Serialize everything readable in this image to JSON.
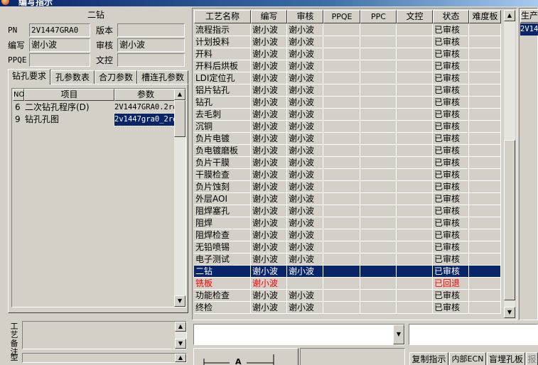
{
  "window": {
    "title": "编写指示"
  },
  "header": {
    "title": "二钻"
  },
  "fields": {
    "pn_label": "PN",
    "pn_value": "2V1447GRA0",
    "version_label": "版本",
    "version_value": "",
    "writer_label": "编写",
    "writer_value": "谢小波",
    "reviewer_label": "审核",
    "reviewer_value": "谢小波",
    "ppqe_label": "PPQE",
    "ppqe_value": "",
    "doc_control_label": "文控",
    "doc_control_value": ""
  },
  "tabs": [
    "钻孔要求",
    "孔参数表",
    "合刀参数",
    "槽连孔参数"
  ],
  "left_grid": {
    "headers": [
      "NO",
      "项目",
      "参数"
    ],
    "rows": [
      {
        "no": "6",
        "item": "二次钻孔程序(D)",
        "param": "2V1447GRA0.2rd"
      },
      {
        "no": "9",
        "item": "钻孔孔图",
        "param": "2v1447gra0_2rd"
      }
    ]
  },
  "remarks": {
    "label1": "工艺备注",
    "label2": "型"
  },
  "main_grid": {
    "headers": [
      "工艺名称",
      "编写",
      "审核",
      "PPQE",
      "PPC",
      "文控",
      "状态",
      "难度板"
    ],
    "rows": [
      {
        "name": "流程指示",
        "writer": "谢小波",
        "reviewer": "谢小波",
        "status": "已审核"
      },
      {
        "name": "计划投料",
        "writer": "谢小波",
        "reviewer": "谢小波",
        "status": "已审核"
      },
      {
        "name": "开料",
        "writer": "谢小波",
        "reviewer": "谢小波",
        "status": "已审核"
      },
      {
        "name": "开料后烘板",
        "writer": "谢小波",
        "reviewer": "谢小波",
        "status": "已审核"
      },
      {
        "name": "LDI定位孔",
        "writer": "谢小波",
        "reviewer": "谢小波",
        "status": "已审核"
      },
      {
        "name": "铝片钻孔",
        "writer": "谢小波",
        "reviewer": "谢小波",
        "status": "已审核"
      },
      {
        "name": "钻孔",
        "writer": "谢小波",
        "reviewer": "谢小波",
        "status": "已审核"
      },
      {
        "name": "去毛刺",
        "writer": "谢小波",
        "reviewer": "谢小波",
        "status": "已审核"
      },
      {
        "name": "沉铜",
        "writer": "谢小波",
        "reviewer": "谢小波",
        "status": "已审核"
      },
      {
        "name": "负片电镀",
        "writer": "谢小波",
        "reviewer": "谢小波",
        "status": "已审核"
      },
      {
        "name": "负电镀磨板",
        "writer": "谢小波",
        "reviewer": "谢小波",
        "status": "已审核"
      },
      {
        "name": "负片干膜",
        "writer": "谢小波",
        "reviewer": "谢小波",
        "status": "已审核"
      },
      {
        "name": "干膜检查",
        "writer": "谢小波",
        "reviewer": "谢小波",
        "status": "已审核"
      },
      {
        "name": "负片蚀刻",
        "writer": "谢小波",
        "reviewer": "谢小波",
        "status": "已审核"
      },
      {
        "name": "外层AOI",
        "writer": "谢小波",
        "reviewer": "谢小波",
        "status": "已审核"
      },
      {
        "name": "阻焊塞孔",
        "writer": "谢小波",
        "reviewer": "谢小波",
        "status": "已审核"
      },
      {
        "name": "阻焊",
        "writer": "谢小波",
        "reviewer": "谢小波",
        "status": "已审核"
      },
      {
        "name": "阻焊检查",
        "writer": "谢小波",
        "reviewer": "谢小波",
        "status": "已审核"
      },
      {
        "name": "无铅喷锡",
        "writer": "谢小波",
        "reviewer": "谢小波",
        "status": "已审核"
      },
      {
        "name": "电子测试",
        "writer": "谢小波",
        "reviewer": "谢小波",
        "status": "已审核"
      },
      {
        "name": "二钻",
        "writer": "谢小波",
        "reviewer": "谢小波",
        "status": "已审核"
      },
      {
        "name": "铣板",
        "writer": "谢小波",
        "reviewer": "",
        "status": "已回退"
      },
      {
        "name": "功能检查",
        "writer": "谢小波",
        "reviewer": "谢小波",
        "status": "已审核"
      },
      {
        "name": "终检",
        "writer": "谢小波",
        "reviewer": "谢小波",
        "status": "已审核"
      }
    ]
  },
  "right_panel": {
    "header": "生产",
    "value": "2V14"
  },
  "bottom_buttons": [
    "复制指示",
    "内部ECN",
    "盲埋孔板",
    "报"
  ],
  "colors": {
    "face": "#d4d0c8",
    "selection": "#0a246a",
    "rollback": "#ff0000"
  }
}
